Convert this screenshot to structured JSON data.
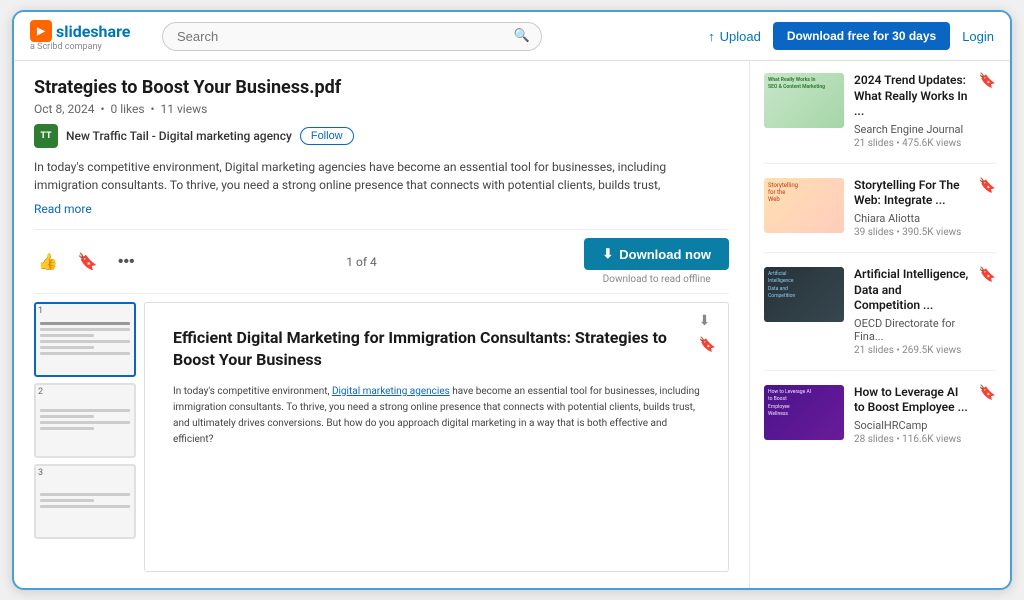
{
  "header": {
    "logo_name": "slideshare",
    "logo_sub": "a Scribd company",
    "search_placeholder": "Search",
    "upload_label": "Upload",
    "download_free_label": "Download free for 30 days",
    "login_label": "Login"
  },
  "document": {
    "title": "Strategies to Boost Your Business.pdf",
    "date": "Oct 8, 2024",
    "likes": "0 likes",
    "views": "11 views",
    "author_name": "New Traffic Tail - Digital marketing agency",
    "follow_label": "Follow",
    "description": "In today's competitive environment, Digital marketing agencies have become an essential tool for businesses, including immigration consultants. To thrive, you need a strong online presence that connects with potential clients, builds trust,",
    "read_more": "Read more",
    "page_indicator": "1 of 4",
    "download_now_label": "Download now",
    "download_sub": "Download to read offline"
  },
  "doc_page": {
    "title": "Efficient Digital Marketing for Immigration Consultants: Strategies to Boost Your Business",
    "body": "In today's competitive environment, Digital marketing agencies have become an essential tool for businesses, including immigration consultants. To thrive, you need a strong online presence that connects with potential clients, builds trust, and ultimately drives conversions. But how do you approach digital marketing in a way that is both effective and efficient?"
  },
  "sidebar": {
    "items": [
      {
        "title": "2024 Trend Updates: What Really Works In ...",
        "author": "Search Engine Journal",
        "meta": "21 slides • 475.6K views",
        "thumb_type": "seo"
      },
      {
        "title": "Storytelling For The Web: Integrate ...",
        "author": "Chiara Aliotta",
        "meta": "39 slides • 390.5K views",
        "thumb_type": "storytelling"
      },
      {
        "title": "Artificial Intelligence, Data and Competition ...",
        "author": "OECD Directorate for Fina...",
        "meta": "21 slides • 269.5K views",
        "thumb_type": "ai"
      },
      {
        "title": "How to Leverage AI to Boost Employee ...",
        "author": "SocialHRCamp",
        "meta": "28 slides • 116.6K views",
        "thumb_type": "leverage"
      }
    ]
  },
  "thumbnails": [
    {
      "num": "1",
      "active": true
    },
    {
      "num": "2",
      "active": false
    },
    {
      "num": "3",
      "active": false
    }
  ]
}
